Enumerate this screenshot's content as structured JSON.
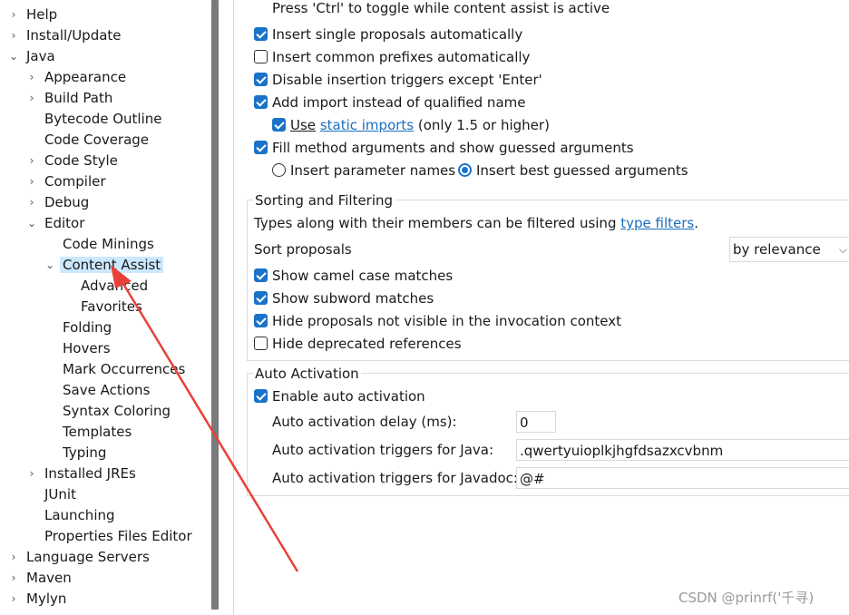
{
  "tree": {
    "items": [
      {
        "label": "Help",
        "chevron": "›"
      },
      {
        "label": "Install/Update",
        "chevron": "›"
      },
      {
        "label": "Java",
        "chevron": "⌄"
      },
      {
        "label": "Appearance",
        "chevron": "›"
      },
      {
        "label": "Build Path",
        "chevron": "›"
      },
      {
        "label": "Bytecode Outline",
        "chevron": ""
      },
      {
        "label": "Code Coverage",
        "chevron": ""
      },
      {
        "label": "Code Style",
        "chevron": "›"
      },
      {
        "label": "Compiler",
        "chevron": "›"
      },
      {
        "label": "Debug",
        "chevron": "›"
      },
      {
        "label": "Editor",
        "chevron": "⌄"
      },
      {
        "label": "Code Minings",
        "chevron": ""
      },
      {
        "label": "Content Assist",
        "chevron": "⌄",
        "selected": true
      },
      {
        "label": "Advanced",
        "chevron": ""
      },
      {
        "label": "Favorites",
        "chevron": ""
      },
      {
        "label": "Folding",
        "chevron": ""
      },
      {
        "label": "Hovers",
        "chevron": ""
      },
      {
        "label": "Mark Occurrences",
        "chevron": ""
      },
      {
        "label": "Save Actions",
        "chevron": ""
      },
      {
        "label": "Syntax Coloring",
        "chevron": ""
      },
      {
        "label": "Templates",
        "chevron": ""
      },
      {
        "label": "Typing",
        "chevron": ""
      },
      {
        "label": "Installed JREs",
        "chevron": "›"
      },
      {
        "label": "JUnit",
        "chevron": ""
      },
      {
        "label": "Launching",
        "chevron": ""
      },
      {
        "label": "Properties Files Editor",
        "chevron": ""
      },
      {
        "label": "Language Servers",
        "chevron": "›"
      },
      {
        "label": "Maven",
        "chevron": "›"
      },
      {
        "label": "Mylyn",
        "chevron": "›"
      }
    ]
  },
  "insertion": {
    "hint": "Press 'Ctrl' to toggle while content assist is active",
    "single_proposals": {
      "label": "Insert single proposals automatically",
      "checked": true
    },
    "common_prefixes": {
      "label": "Insert common prefixes automatically",
      "checked": false
    },
    "disable_triggers": {
      "label": "Disable insertion triggers except 'Enter'",
      "checked": true
    },
    "add_import": {
      "label": "Add import instead of qualified name",
      "checked": true
    },
    "use_static": {
      "use": "Use",
      "link": "static imports",
      "suffix": "(only 1.5 or higher)",
      "checked": true
    },
    "fill_args": {
      "label": "Fill method arguments and show guessed arguments",
      "checked": true
    },
    "radio_param_names": {
      "label": "Insert parameter names",
      "selected": false
    },
    "radio_best_guess": {
      "label": "Insert best guessed arguments",
      "selected": true
    }
  },
  "sorting": {
    "title": "Sorting and Filtering",
    "types_text": "Types along with their members can be filtered using",
    "types_link": "type filters",
    "types_end": ".",
    "sort_label": "Sort proposals",
    "sort_value": "by relevance",
    "camel": {
      "label": "Show camel case matches",
      "checked": true
    },
    "subword": {
      "label": "Show subword matches",
      "checked": true
    },
    "hide_invisible": {
      "label": "Hide proposals not visible in the invocation context",
      "checked": true
    },
    "hide_deprecated": {
      "label": "Hide deprecated references",
      "checked": false
    }
  },
  "auto": {
    "title": "Auto Activation",
    "enable": {
      "label": "Enable auto activation",
      "checked": true
    },
    "delay_label": "Auto activation delay (ms):",
    "delay_value": "0",
    "java_label": "Auto activation triggers for Java:",
    "java_value": ".qwertyuioplkjhgfdsazxcvbnm",
    "javadoc_label": "Auto activation triggers for Javadoc:",
    "javadoc_value": "@#"
  },
  "watermark": "CSDN @prinrf('千寻)",
  "colors": {
    "accent": "#1a73c9",
    "selection": "#cce8ff",
    "arrow": "#e8413a"
  }
}
